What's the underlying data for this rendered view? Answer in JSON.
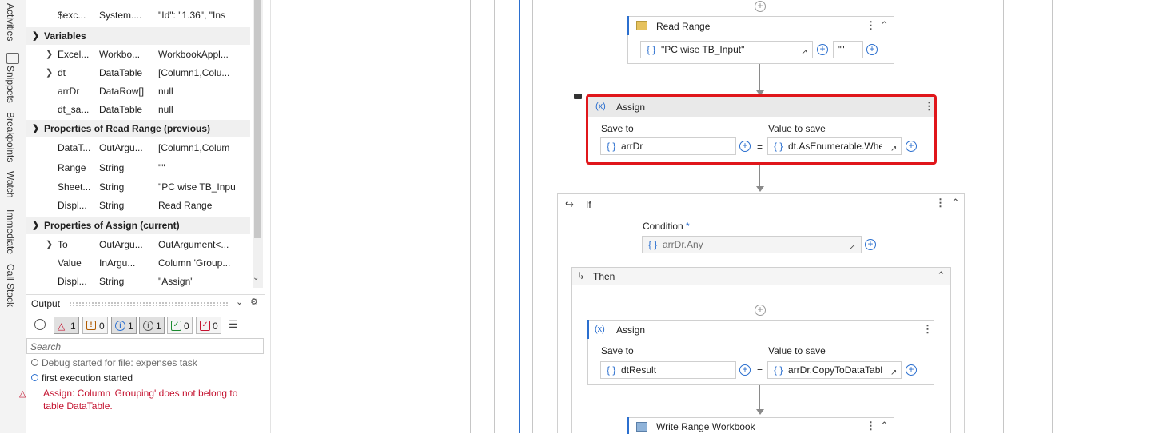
{
  "side_tabs": [
    "Activities",
    "Snippets",
    "Breakpoints",
    "Watch",
    "Immediate",
    "Call Stack"
  ],
  "variables_top_row": {
    "name": "$exc...",
    "type": "System....",
    "value": "\"Id\": \"1.36\",  \"Ins"
  },
  "sections": {
    "variables": "Variables",
    "read_range_props": "Properties of Read Range (previous)",
    "assign_props": "Properties of Assign (current)"
  },
  "variables": [
    {
      "name": "Excel...",
      "type": "Workbo...",
      "value": "WorkbookAppl..."
    },
    {
      "name": "dt",
      "type": "DataTable",
      "value": "[Column1,Colu..."
    },
    {
      "name": "arrDr",
      "type": "DataRow[]",
      "value": "null"
    },
    {
      "name": "dt_sa...",
      "type": "DataTable",
      "value": "null"
    }
  ],
  "read_range_properties": [
    {
      "name": "DataT...",
      "type": "OutArgu...",
      "value": "[Column1,Colum"
    },
    {
      "name": "Range",
      "type": "String",
      "value": "\"\""
    },
    {
      "name": "Sheet...",
      "type": "String",
      "value": "\"PC wise TB_Inpu"
    },
    {
      "name": "Displ...",
      "type": "String",
      "value": "Read Range"
    }
  ],
  "assign_properties": [
    {
      "name": "To",
      "type": "OutArgu...",
      "value": "OutArgument<..."
    },
    {
      "name": "Value",
      "type": "InArgu...",
      "value": "Column 'Group..."
    },
    {
      "name": "Displ...",
      "type": "String",
      "value": "\"Assign\""
    }
  ],
  "output": {
    "title": "Output",
    "filters": [
      {
        "icon": "error-icon",
        "count": "1"
      },
      {
        "icon": "warning-icon",
        "count": "0"
      },
      {
        "icon": "info-icon",
        "count": "1"
      },
      {
        "icon": "trace-icon",
        "count": "1"
      },
      {
        "icon": "success-icon",
        "count": "0"
      },
      {
        "icon": "verbose-icon",
        "count": "0"
      }
    ],
    "search_placeholder": "Search",
    "messages": [
      {
        "kind": "debug",
        "text": "Debug started for file: expenses task"
      },
      {
        "kind": "info",
        "text": "first execution started"
      },
      {
        "kind": "error",
        "text": "Assign: Column 'Grouping' does not belong to table DataTable."
      }
    ],
    "colors": {
      "error": "#c4122f",
      "info": "#2b6fcf",
      "debug": "#6a6a6a"
    }
  },
  "workflow": {
    "read_range": {
      "title": "Read Range",
      "sheet": "\"PC wise TB_Input\"",
      "range": "\"\""
    },
    "assign1": {
      "title": "Assign",
      "save_to_label": "Save to",
      "value_label": "Value to save",
      "save_to": "arrDr",
      "value": "dt.AsEnumerable.Whe",
      "equals": "="
    },
    "if": {
      "title": "If",
      "condition_label": "Condition",
      "required_mark": "*",
      "condition": "arrDr.Any"
    },
    "then": {
      "title": "Then"
    },
    "assign2": {
      "title": "Assign",
      "save_to_label": "Save to",
      "value_label": "Value to save",
      "save_to": "dtResult",
      "value": "arrDr.CopyToDataTable",
      "equals": "="
    },
    "write_range": {
      "title": "Write Range Workbook"
    }
  },
  "accent_colors": {
    "selection_border": "#e0161b",
    "brace_blue": "#2b6fcf"
  }
}
